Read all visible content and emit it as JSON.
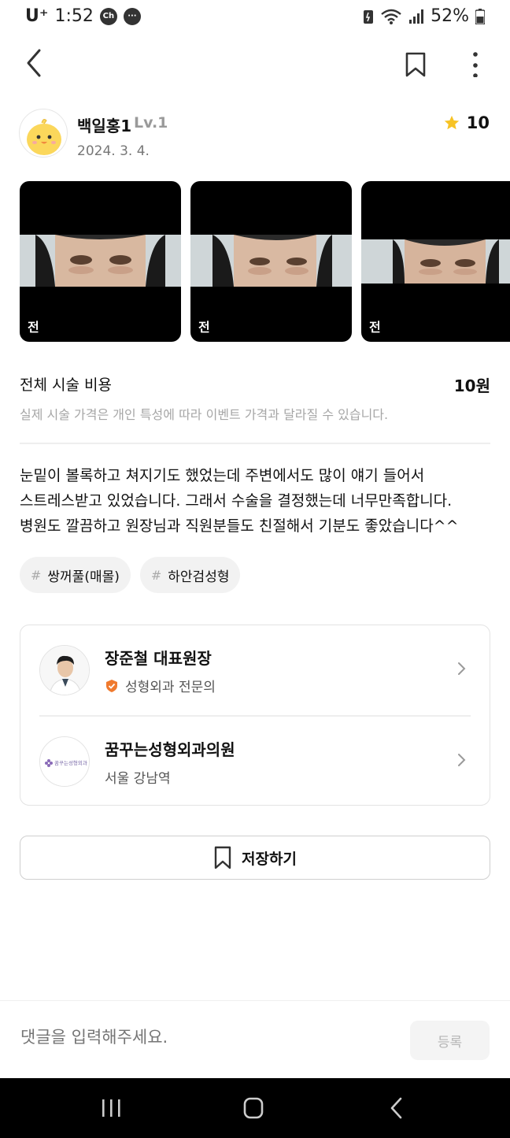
{
  "status_bar": {
    "carrier": "U⁺",
    "time": "1:52",
    "battery": "52%"
  },
  "author": {
    "name": "백일홍1",
    "level": "Lv.1",
    "date": "2024. 3. 4.",
    "rating": "10"
  },
  "photos": [
    {
      "label": "전"
    },
    {
      "label": "전"
    },
    {
      "label": "전"
    }
  ],
  "cost": {
    "label": "전체 시술 비용",
    "value": "10원",
    "note": "실제 시술 가격은 개인 특성에 따라 이벤트 가격과 달라질 수 있습니다."
  },
  "review": {
    "lines": [
      "눈밑이 볼록하고 쳐지기도 했었는데 주변에서도 많이 얘기 들어서",
      "스트레스받고 있었습니다. 그래서 수술을 결정했는데 너무만족합니다.",
      "병원도 깔끔하고 원장님과 직원분들도 친절해서 기분도 좋았습니다^^"
    ]
  },
  "tags": [
    {
      "hash": "#",
      "label": "쌍꺼풀(매몰)"
    },
    {
      "hash": "#",
      "label": "하안검성형"
    }
  ],
  "doctor": {
    "name": "장준철 대표원장",
    "specialty": "성형외과 전문의"
  },
  "clinic": {
    "name": "꿈꾸는성형외과의원",
    "location": "서울 강남역",
    "logo_text": "꿈꾸는성형외과"
  },
  "save_button": {
    "label": "저장하기"
  },
  "comment": {
    "placeholder": "댓글을 입력해주세요.",
    "submit_label": "등록"
  },
  "colors": {
    "star": "#f7c325",
    "badge": "#f07a2e",
    "text_primary": "#111111",
    "text_muted": "#a6a6a6"
  },
  "icons": [
    "back-arrow-icon",
    "bookmark-icon",
    "more-vert-icon",
    "star-icon",
    "verified-badge-icon",
    "chevron-right-icon",
    "recent-apps-icon",
    "home-icon",
    "nav-back-icon"
  ]
}
